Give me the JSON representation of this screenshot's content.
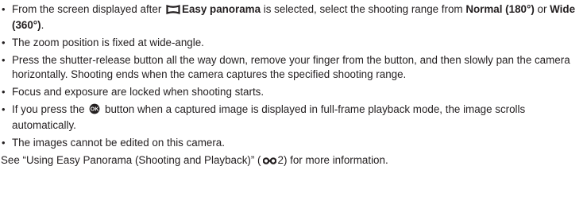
{
  "bullets": [
    {
      "pre": "From the screen displayed after ",
      "icon": "panorama-icon",
      "bold1": "Easy panorama",
      "mid1": " is selected, select the shooting range from ",
      "bold2": "Normal (180°)",
      "mid2": " or ",
      "bold3": "Wide (360°)",
      "post": "."
    },
    {
      "text": "The zoom position is fixed at wide-angle."
    },
    {
      "text": "Press the shutter-release button all the way down, remove your finger from the button, and then slowly pan the camera horizontally. Shooting ends when the camera captures the specified shooting range."
    },
    {
      "text": "Focus and exposure are locked when shooting starts."
    },
    {
      "pre": "If you press the ",
      "icon": "ok-button-icon",
      "post": " button when a captured image is displayed in full-frame playback mode, the image scrolls automatically."
    },
    {
      "text": "The images cannot be edited on this camera."
    }
  ],
  "footer": {
    "pre": "See “Using Easy Panorama (Shooting and Playback)” (",
    "icon": "reference-link-icon",
    "page": "2",
    "post": ") for more information."
  }
}
